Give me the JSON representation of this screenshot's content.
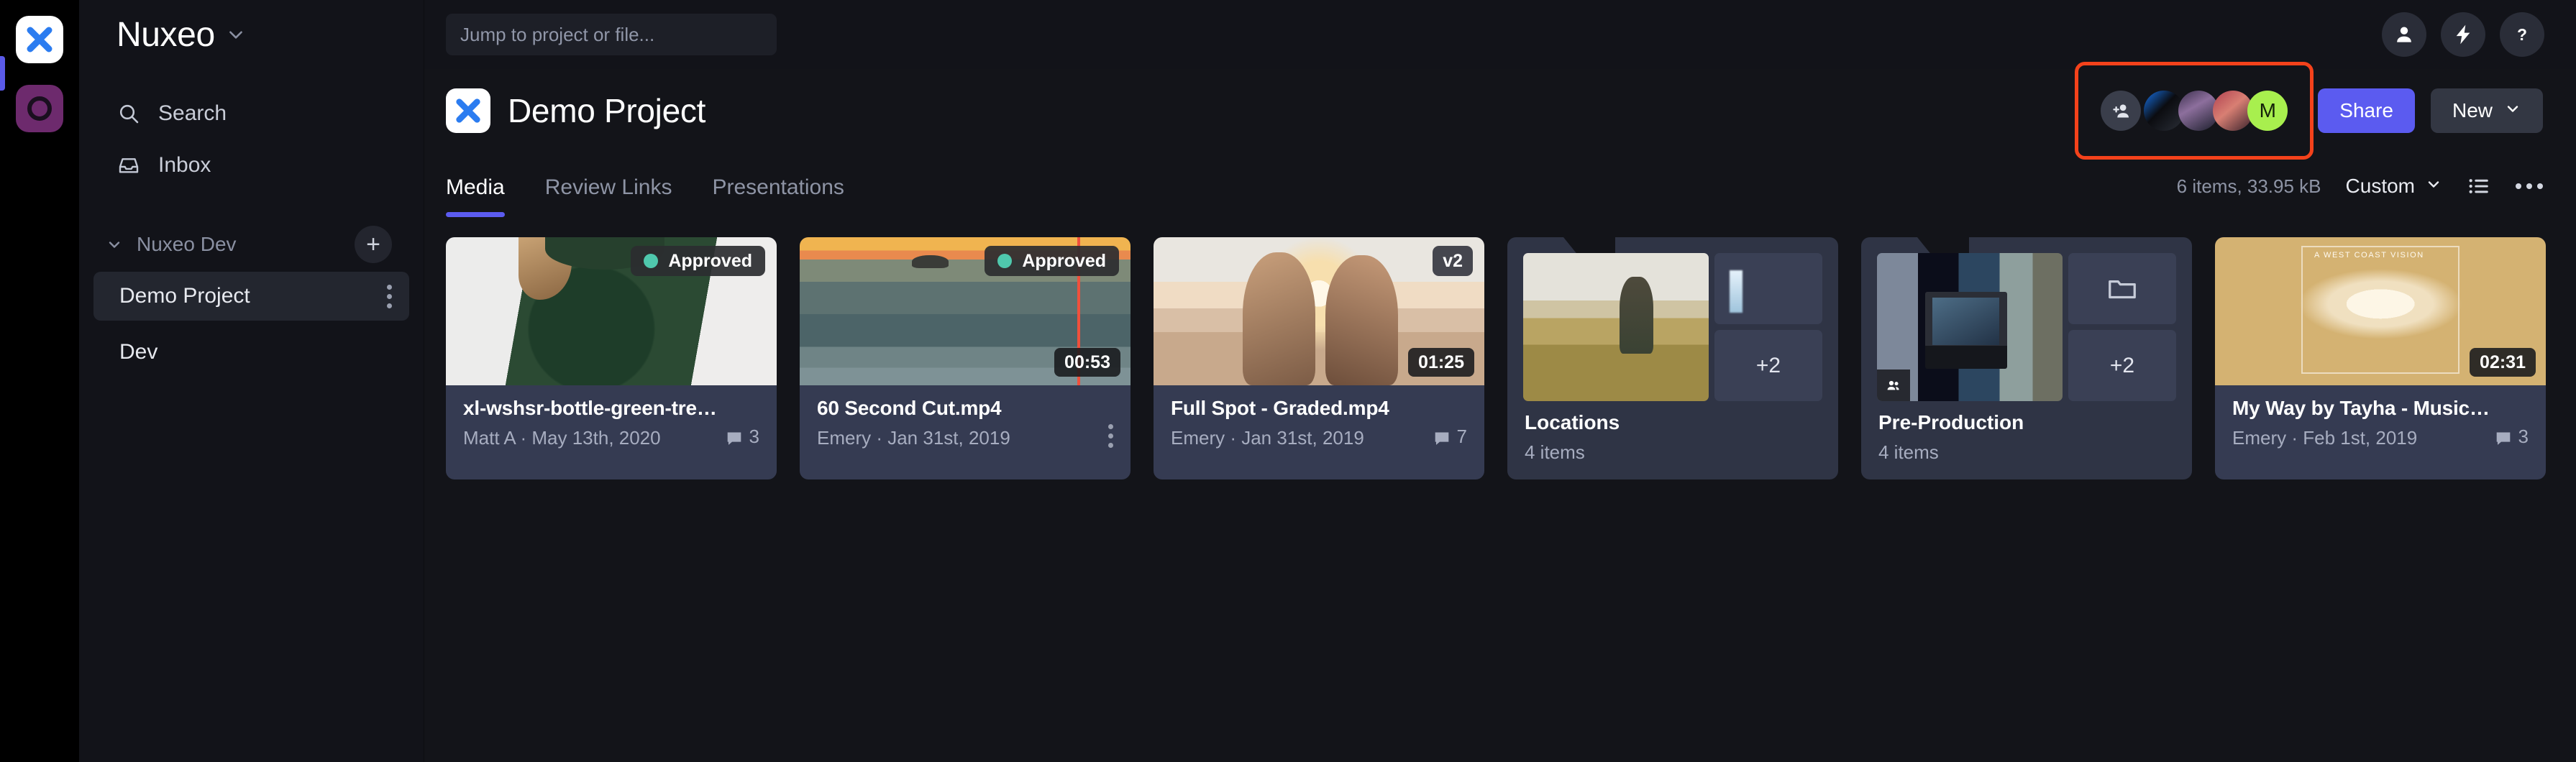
{
  "rail": {
    "apps": [
      {
        "name": "frameio-app-icon",
        "glyph": "X"
      },
      {
        "name": "other-workspace-icon",
        "glyph": "O"
      }
    ]
  },
  "sidebar": {
    "workspace_name": "Nuxeo",
    "nav": [
      {
        "label": "Search",
        "icon": "search-icon"
      },
      {
        "label": "Inbox",
        "icon": "inbox-icon"
      }
    ],
    "tree": {
      "group_label": "Nuxeo Dev",
      "add_label": "+",
      "items": [
        {
          "label": "Demo Project",
          "active": true
        },
        {
          "label": "Dev",
          "active": false
        }
      ]
    }
  },
  "topbar": {
    "search_placeholder": "Jump to project or file...",
    "actions": [
      {
        "name": "account-icon"
      },
      {
        "name": "lightning-icon"
      },
      {
        "name": "help-icon"
      }
    ]
  },
  "project": {
    "title": "Demo Project",
    "share_label": "Share",
    "new_label": "New",
    "collaborators": [
      {
        "type": "add",
        "label": "+"
      },
      {
        "type": "photo",
        "label": ""
      },
      {
        "type": "photo",
        "label": ""
      },
      {
        "type": "photo",
        "label": ""
      },
      {
        "type": "initial",
        "label": "M"
      }
    ],
    "highlight_color": "#f4421b",
    "accent_color": "#5b5bf0"
  },
  "tabs": [
    {
      "label": "Media",
      "active": true
    },
    {
      "label": "Review Links",
      "active": false
    },
    {
      "label": "Presentations",
      "active": false
    }
  ],
  "toolbar": {
    "items_summary": "6 items, 33.95 kB",
    "sort_label": "Custom",
    "list_view_icon": "list-view-icon",
    "more_icon": "more-horizontal-icon"
  },
  "assets": [
    {
      "kind": "file",
      "name": "xl-wshsr-bottle-green-trend...",
      "author": "Matt A",
      "date": "May 13th, 2020",
      "meta": "Matt A · May 13th, 2020",
      "status": "Approved",
      "comments": "3",
      "duration": "",
      "version": "",
      "art": "art-tee"
    },
    {
      "kind": "file",
      "name": "60 Second Cut.mp4",
      "author": "Emery",
      "date": "Jan 31st, 2019",
      "meta": "Emery · Jan 31st, 2019",
      "status": "Approved",
      "comments": "",
      "duration": "00:53",
      "version": "",
      "art": "art-ocean",
      "hovered": true
    },
    {
      "kind": "file",
      "name": "Full Spot - Graded.mp4",
      "author": "Emery",
      "date": "Jan 31st, 2019",
      "meta": "Emery · Jan 31st, 2019",
      "status": "",
      "comments": "7",
      "duration": "01:25",
      "version": "v2",
      "art": "art-sunset"
    },
    {
      "kind": "folder",
      "name": "Locations",
      "count": "4 items",
      "more_label": "+2",
      "side_top": "thumb",
      "art_main": "art-field",
      "art_side": "art-falls"
    },
    {
      "kind": "folder",
      "name": "Pre-Production",
      "count": "4 items",
      "more_label": "+2",
      "side_top": "folder",
      "art_main": "art-mosaic",
      "art_side": ""
    },
    {
      "kind": "file",
      "name": "My Way by Tayha - MusicBe...",
      "author": "Emery",
      "date": "Feb 1st, 2019",
      "meta": "Emery · Feb 1st, 2019",
      "status": "",
      "comments": "3",
      "duration": "02:31",
      "version": "",
      "art": "art-gold",
      "art_caption": "A WEST COAST VISION"
    }
  ]
}
